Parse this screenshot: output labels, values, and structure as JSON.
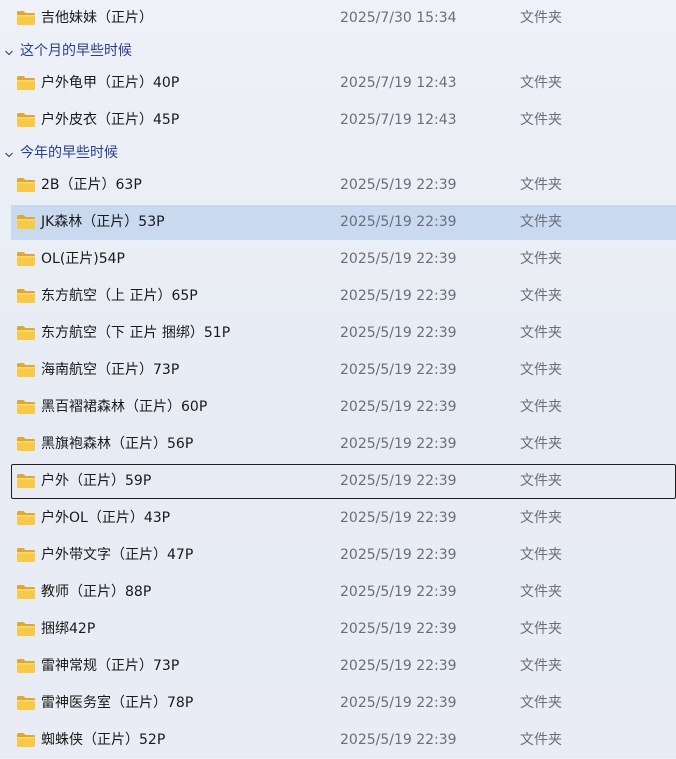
{
  "colors": {
    "background": "#eaeef5",
    "group_header": "#2b3f8f",
    "selected_row": "#c9daf0",
    "folder": "#f5c443",
    "meta_text": "#6b6e78"
  },
  "sections": [
    {
      "header": null,
      "rows": [
        {
          "name": "吉他妹妹（正片）",
          "date": "2025/7/30 15:34",
          "type": "文件夹",
          "icon": "folder-icon"
        }
      ]
    },
    {
      "header": "这个月的早些时候",
      "rows": [
        {
          "name": "户外龟甲（正片）40P",
          "date": "2025/7/19 12:43",
          "type": "文件夹",
          "icon": "folder-icon"
        },
        {
          "name": "户外皮衣（正片）45P",
          "date": "2025/7/19 12:43",
          "type": "文件夹",
          "icon": "folder-icon"
        }
      ]
    },
    {
      "header": "今年的早些时候",
      "rows": [
        {
          "name": "2B（正片）63P",
          "date": "2025/5/19 22:39",
          "type": "文件夹",
          "icon": "folder-icon"
        },
        {
          "name": "JK森林（正片）53P",
          "date": "2025/5/19 22:39",
          "type": "文件夹",
          "icon": "folder-icon",
          "selected": true
        },
        {
          "name": "OL(正片)54P",
          "date": "2025/5/19 22:39",
          "type": "文件夹",
          "icon": "folder-icon"
        },
        {
          "name": "东方航空（上 正片）65P",
          "date": "2025/5/19 22:39",
          "type": "文件夹",
          "icon": "folder-icon"
        },
        {
          "name": "东方航空（下 正片 捆绑）51P",
          "date": "2025/5/19 22:39",
          "type": "文件夹",
          "icon": "folder-icon"
        },
        {
          "name": "海南航空（正片）73P",
          "date": "2025/5/19 22:39",
          "type": "文件夹",
          "icon": "folder-icon"
        },
        {
          "name": "黑百褶裙森林（正片）60P",
          "date": "2025/5/19 22:39",
          "type": "文件夹",
          "icon": "folder-icon"
        },
        {
          "name": "黑旗袍森林（正片）56P",
          "date": "2025/5/19 22:39",
          "type": "文件夹",
          "icon": "folder-icon"
        },
        {
          "name": "户外（正片）59P",
          "date": "2025/5/19 22:39",
          "type": "文件夹",
          "icon": "folder-icon",
          "focused": true
        },
        {
          "name": "户外OL（正片）43P",
          "date": "2025/5/19 22:39",
          "type": "文件夹",
          "icon": "folder-icon"
        },
        {
          "name": "户外带文字（正片）47P",
          "date": "2025/5/19 22:39",
          "type": "文件夹",
          "icon": "folder-icon"
        },
        {
          "name": "教师（正片）88P",
          "date": "2025/5/19 22:39",
          "type": "文件夹",
          "icon": "folder-icon"
        },
        {
          "name": "捆绑42P",
          "date": "2025/5/19 22:39",
          "type": "文件夹",
          "icon": "folder-icon"
        },
        {
          "name": "雷神常规（正片）73P",
          "date": "2025/5/19 22:39",
          "type": "文件夹",
          "icon": "folder-icon"
        },
        {
          "name": "雷神医务室（正片）78P",
          "date": "2025/5/19 22:39",
          "type": "文件夹",
          "icon": "folder-icon"
        },
        {
          "name": "蜘蛛侠（正片）52P",
          "date": "2025/5/19 22:39",
          "type": "文件夹",
          "icon": "folder-icon"
        }
      ]
    }
  ]
}
